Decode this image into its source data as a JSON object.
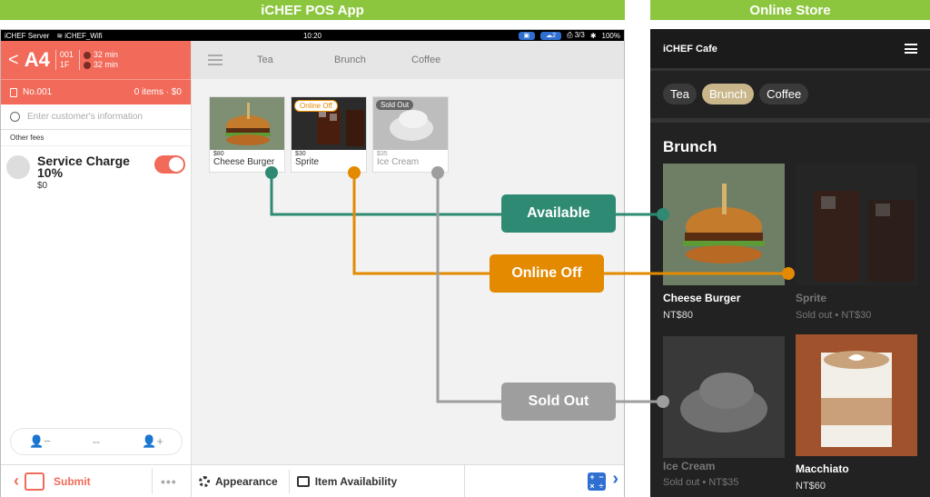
{
  "banners": {
    "pos": "iCHEF POS App",
    "online": "Online Store"
  },
  "statusbar": {
    "carrier": "iCHEF Server",
    "wifi": "iCHEF_Wifi",
    "time": "10:20",
    "pill_count": "2",
    "ratio": "3/3",
    "battery": "100%"
  },
  "order": {
    "back": "<",
    "table": "A4",
    "seat_no": "001",
    "floor": "1F",
    "timers": [
      "32 min",
      "32 min"
    ],
    "order_no": "No.001",
    "items": "0 items · $0",
    "customer_placeholder": "Enter customer's information",
    "other_fees": "Other fees",
    "fee_name": "Service Charge 10%",
    "fee_price": "$0",
    "guest_count": "--",
    "submit": "Submit",
    "more": "•••"
  },
  "menu": {
    "tabs": [
      "Tea",
      "Brunch",
      "Coffee"
    ],
    "items": [
      {
        "price": "$80",
        "name": "Cheese Burger",
        "badge": ""
      },
      {
        "price": "$30",
        "name": "Sprite",
        "badge": "Online Off"
      },
      {
        "price": "$35",
        "name": "Ice Cream",
        "badge": "Sold Out"
      }
    ],
    "appearance": "Appearance",
    "item_availability": "Item Availability"
  },
  "callouts": {
    "available": "Available",
    "online_off": "Online Off",
    "sold_out": "Sold Out"
  },
  "store": {
    "title": "iCHEF Cafe",
    "tabs": [
      "Tea",
      "Brunch",
      "Coffee"
    ],
    "section": "Brunch",
    "items": [
      {
        "name": "Cheese Burger",
        "price": "NT$80"
      },
      {
        "name": "Sprite",
        "price": "Sold out • NT$30"
      },
      {
        "name": "Ice Cream",
        "price": "Sold out • NT$35"
      },
      {
        "name": "Macchiato",
        "price": "NT$60"
      }
    ]
  },
  "colors": {
    "accent_red": "#f26a5a",
    "available": "#2e8a73",
    "online_off": "#e48a00",
    "sold_out": "#9e9e9e",
    "banner": "#8cc63f"
  }
}
